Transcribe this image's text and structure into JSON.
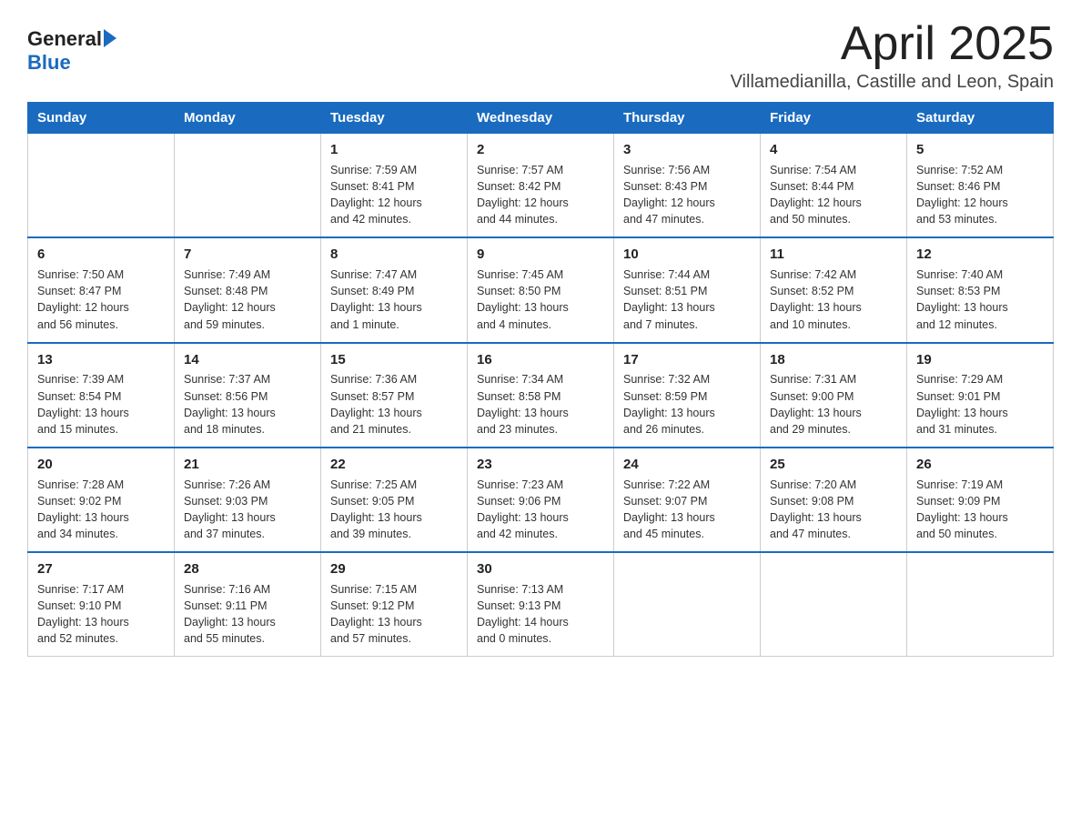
{
  "header": {
    "logo": {
      "text_general": "General",
      "text_blue": "Blue",
      "arrow_char": "▶"
    },
    "title": "April 2025",
    "subtitle": "Villamedianilla, Castille and Leon, Spain"
  },
  "weekdays": [
    "Sunday",
    "Monday",
    "Tuesday",
    "Wednesday",
    "Thursday",
    "Friday",
    "Saturday"
  ],
  "weeks": [
    [
      {
        "day": "",
        "info": ""
      },
      {
        "day": "",
        "info": ""
      },
      {
        "day": "1",
        "info": "Sunrise: 7:59 AM\nSunset: 8:41 PM\nDaylight: 12 hours\nand 42 minutes."
      },
      {
        "day": "2",
        "info": "Sunrise: 7:57 AM\nSunset: 8:42 PM\nDaylight: 12 hours\nand 44 minutes."
      },
      {
        "day": "3",
        "info": "Sunrise: 7:56 AM\nSunset: 8:43 PM\nDaylight: 12 hours\nand 47 minutes."
      },
      {
        "day": "4",
        "info": "Sunrise: 7:54 AM\nSunset: 8:44 PM\nDaylight: 12 hours\nand 50 minutes."
      },
      {
        "day": "5",
        "info": "Sunrise: 7:52 AM\nSunset: 8:46 PM\nDaylight: 12 hours\nand 53 minutes."
      }
    ],
    [
      {
        "day": "6",
        "info": "Sunrise: 7:50 AM\nSunset: 8:47 PM\nDaylight: 12 hours\nand 56 minutes."
      },
      {
        "day": "7",
        "info": "Sunrise: 7:49 AM\nSunset: 8:48 PM\nDaylight: 12 hours\nand 59 minutes."
      },
      {
        "day": "8",
        "info": "Sunrise: 7:47 AM\nSunset: 8:49 PM\nDaylight: 13 hours\nand 1 minute."
      },
      {
        "day": "9",
        "info": "Sunrise: 7:45 AM\nSunset: 8:50 PM\nDaylight: 13 hours\nand 4 minutes."
      },
      {
        "day": "10",
        "info": "Sunrise: 7:44 AM\nSunset: 8:51 PM\nDaylight: 13 hours\nand 7 minutes."
      },
      {
        "day": "11",
        "info": "Sunrise: 7:42 AM\nSunset: 8:52 PM\nDaylight: 13 hours\nand 10 minutes."
      },
      {
        "day": "12",
        "info": "Sunrise: 7:40 AM\nSunset: 8:53 PM\nDaylight: 13 hours\nand 12 minutes."
      }
    ],
    [
      {
        "day": "13",
        "info": "Sunrise: 7:39 AM\nSunset: 8:54 PM\nDaylight: 13 hours\nand 15 minutes."
      },
      {
        "day": "14",
        "info": "Sunrise: 7:37 AM\nSunset: 8:56 PM\nDaylight: 13 hours\nand 18 minutes."
      },
      {
        "day": "15",
        "info": "Sunrise: 7:36 AM\nSunset: 8:57 PM\nDaylight: 13 hours\nand 21 minutes."
      },
      {
        "day": "16",
        "info": "Sunrise: 7:34 AM\nSunset: 8:58 PM\nDaylight: 13 hours\nand 23 minutes."
      },
      {
        "day": "17",
        "info": "Sunrise: 7:32 AM\nSunset: 8:59 PM\nDaylight: 13 hours\nand 26 minutes."
      },
      {
        "day": "18",
        "info": "Sunrise: 7:31 AM\nSunset: 9:00 PM\nDaylight: 13 hours\nand 29 minutes."
      },
      {
        "day": "19",
        "info": "Sunrise: 7:29 AM\nSunset: 9:01 PM\nDaylight: 13 hours\nand 31 minutes."
      }
    ],
    [
      {
        "day": "20",
        "info": "Sunrise: 7:28 AM\nSunset: 9:02 PM\nDaylight: 13 hours\nand 34 minutes."
      },
      {
        "day": "21",
        "info": "Sunrise: 7:26 AM\nSunset: 9:03 PM\nDaylight: 13 hours\nand 37 minutes."
      },
      {
        "day": "22",
        "info": "Sunrise: 7:25 AM\nSunset: 9:05 PM\nDaylight: 13 hours\nand 39 minutes."
      },
      {
        "day": "23",
        "info": "Sunrise: 7:23 AM\nSunset: 9:06 PM\nDaylight: 13 hours\nand 42 minutes."
      },
      {
        "day": "24",
        "info": "Sunrise: 7:22 AM\nSunset: 9:07 PM\nDaylight: 13 hours\nand 45 minutes."
      },
      {
        "day": "25",
        "info": "Sunrise: 7:20 AM\nSunset: 9:08 PM\nDaylight: 13 hours\nand 47 minutes."
      },
      {
        "day": "26",
        "info": "Sunrise: 7:19 AM\nSunset: 9:09 PM\nDaylight: 13 hours\nand 50 minutes."
      }
    ],
    [
      {
        "day": "27",
        "info": "Sunrise: 7:17 AM\nSunset: 9:10 PM\nDaylight: 13 hours\nand 52 minutes."
      },
      {
        "day": "28",
        "info": "Sunrise: 7:16 AM\nSunset: 9:11 PM\nDaylight: 13 hours\nand 55 minutes."
      },
      {
        "day": "29",
        "info": "Sunrise: 7:15 AM\nSunset: 9:12 PM\nDaylight: 13 hours\nand 57 minutes."
      },
      {
        "day": "30",
        "info": "Sunrise: 7:13 AM\nSunset: 9:13 PM\nDaylight: 14 hours\nand 0 minutes."
      },
      {
        "day": "",
        "info": ""
      },
      {
        "day": "",
        "info": ""
      },
      {
        "day": "",
        "info": ""
      }
    ]
  ]
}
